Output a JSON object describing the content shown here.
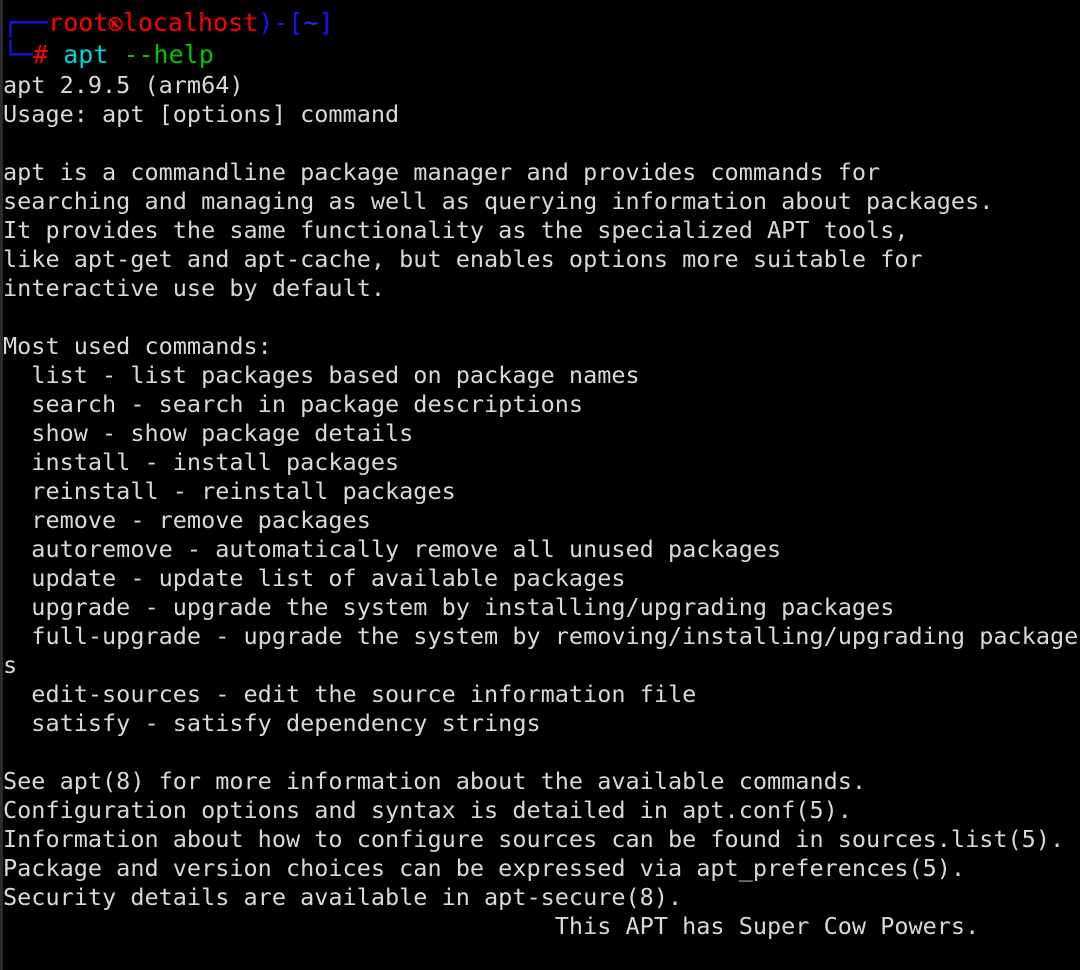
{
  "terminal": {
    "background_color": "#000000",
    "foreground_color": "#d8d8d8",
    "gutter_color": "#2c2c2c",
    "columns": 74,
    "rows": 33
  },
  "prompt": {
    "line1": {
      "box_drawing_prefix": "┌──",
      "user": "root",
      "separator_icon": "kali-dragon-icon",
      "host": "localhost",
      "close_paren": ")-[",
      "path": "~",
      "close_bracket": "]",
      "colors": {
        "box": "#1414ff",
        "user_host": "#ff0000",
        "brackets": "#1414ff",
        "path": "#2a2aff"
      }
    },
    "line2": {
      "box_drawing_prefix": "└─",
      "sigil": "#",
      "command": "apt",
      "args": "--help",
      "colors": {
        "box": "#1414ff",
        "sigil": "#ff0000",
        "command": "#00d7d7",
        "args": "#00c400"
      }
    }
  },
  "output": {
    "version_line": "apt 2.9.5 (arm64)",
    "usage_line": "Usage: apt [options] command",
    "description": [
      "apt is a commandline package manager and provides commands for",
      "searching and managing as well as querying information about packages.",
      "It provides the same functionality as the specialized APT tools,",
      "like apt-get and apt-cache, but enables options more suitable for",
      "interactive use by default."
    ],
    "commands_heading": "Most used commands:",
    "commands": [
      "  list - list packages based on package names",
      "  search - search in package descriptions",
      "  show - show package details",
      "  install - install packages",
      "  reinstall - reinstall packages",
      "  remove - remove packages",
      "  autoremove - automatically remove all unused packages",
      "  update - update list of available packages",
      "  upgrade - upgrade the system by installing/upgrading packages",
      "  full-upgrade - upgrade the system by removing/installing/upgrading package",
      "s",
      "  edit-sources - edit the source information file",
      "  satisfy - satisfy dependency strings"
    ],
    "footer": [
      "See apt(8) for more information about the available commands.",
      "Configuration options and syntax is detailed in apt.conf(5).",
      "Information about how to configure sources can be found in sources.list(5).",
      "Package and version choices can be expressed via apt_preferences(5).",
      "Security details are available in apt-secure(8)."
    ],
    "cow_line": "                                       This APT has Super Cow Powers."
  }
}
